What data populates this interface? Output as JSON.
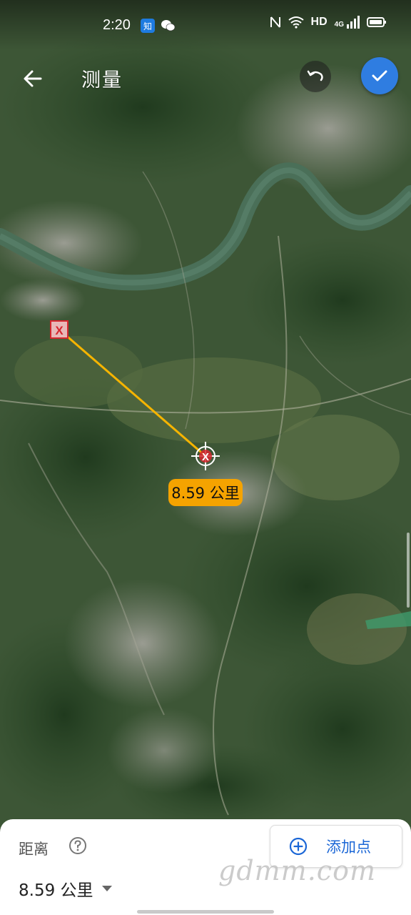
{
  "status_bar": {
    "time": "2:20",
    "network_label": "HD",
    "cell_label": "4G",
    "icons": [
      "zhihu-icon",
      "wechat-icon",
      "nfc-icon",
      "wifi-icon",
      "signal-icon",
      "battery-icon"
    ]
  },
  "toolbar": {
    "title": "测量",
    "back_icon": "arrow-left-icon",
    "undo_icon": "undo-icon",
    "confirm_icon": "checkmark-icon"
  },
  "map": {
    "type": "satellite",
    "distance_label": "8.59 公里",
    "start_marker": "X",
    "end_marker": "X",
    "line_color": "#f5b400"
  },
  "bottom_panel": {
    "label": "距离",
    "help_icon": "help-icon",
    "value": "8.59 公里",
    "add_button_label": "添加点",
    "add_icon": "plus-circle-icon"
  },
  "watermark": "gdmm.com",
  "colors": {
    "accent": "#2f7de1",
    "label_bg": "#f5a300",
    "marker": "#d6272f"
  }
}
